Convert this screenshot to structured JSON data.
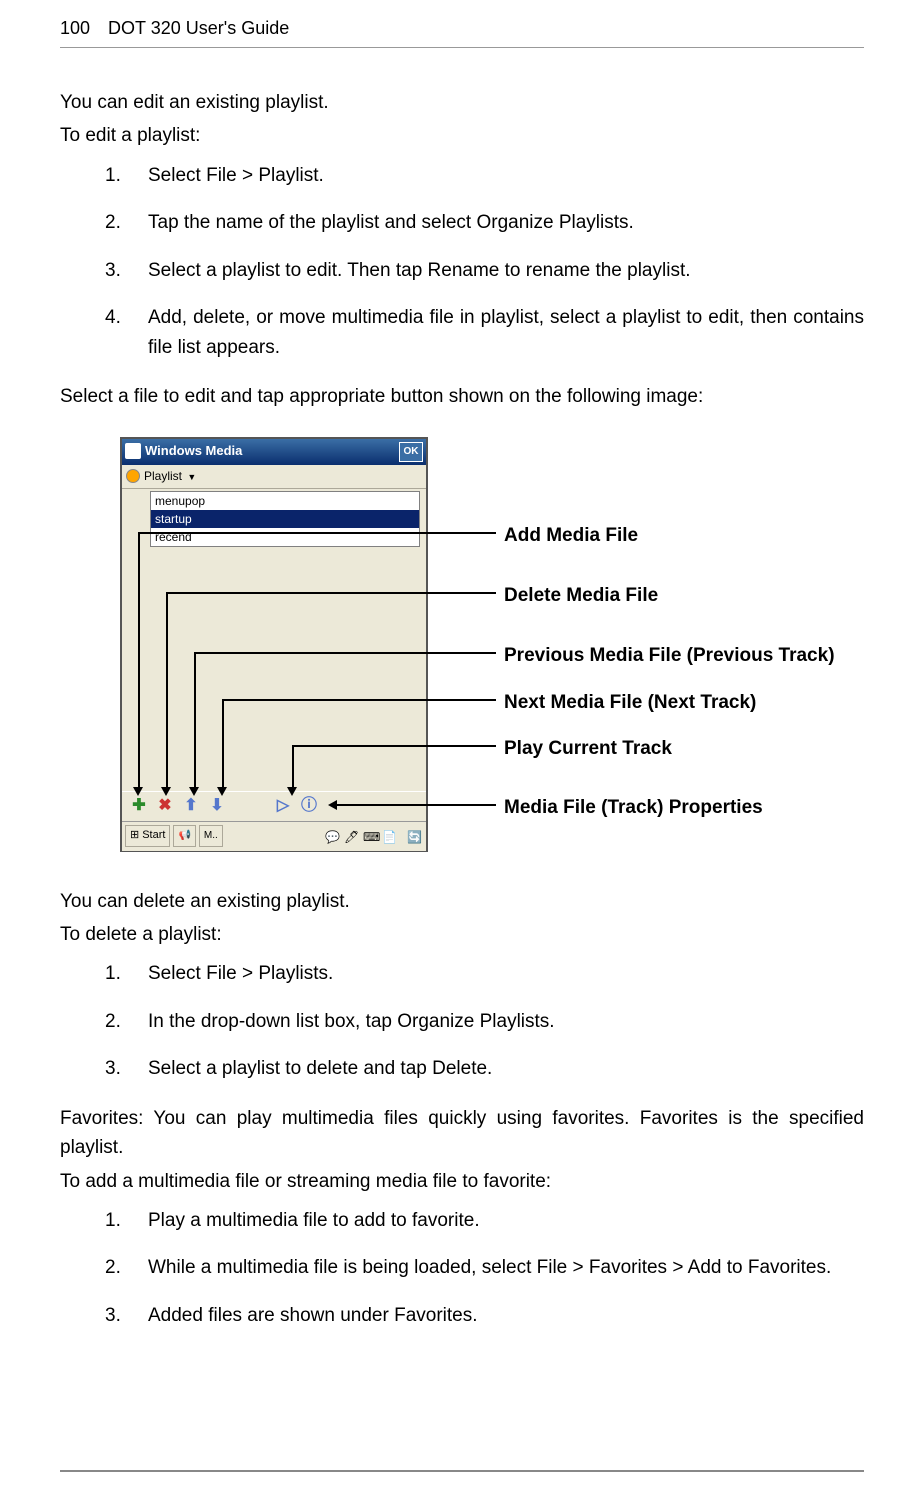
{
  "header": {
    "page_number": "100",
    "title": "DOT 320 User's Guide"
  },
  "section1": {
    "intro": "You can edit an existing playlist.",
    "lead": "To edit a playlist:",
    "steps": [
      "Select File > Playlist.",
      "Tap the name of the playlist and select Organize Playlists.",
      "Select a playlist to edit. Then tap Rename to rename the playlist.",
      "Add, delete, or move multimedia file in playlist, select a playlist to edit, then contains file list appears."
    ],
    "post": "Select a file to edit and tap appropriate button shown on the following image:"
  },
  "screenshot": {
    "titlebar_text": "Windows Media",
    "ok_button": "OK",
    "playlist_label": "Playlist",
    "list_items": [
      "menupop",
      "startup",
      "recend"
    ],
    "selected_index": 1,
    "start_label": "Start",
    "m_label": "M.."
  },
  "annotations": {
    "add": "Add Media File",
    "delete": "Delete Media File",
    "previous": "Previous Media File (Previous Track)",
    "next": "Next Media File (Next Track)",
    "play": "Play Current Track",
    "properties": "Media File (Track) Properties"
  },
  "section2": {
    "intro": "You can delete an existing playlist.",
    "lead": "To delete a playlist:",
    "steps": [
      "Select File > Playlists.",
      "In the drop-down list box, tap Organize Playlists.",
      "Select a playlist to delete and tap Delete."
    ]
  },
  "section3": {
    "intro": "Favorites: You can play multimedia files quickly using favorites. Favorites is the specified playlist.",
    "lead": "To add a multimedia file or streaming media file to favorite:",
    "steps": [
      "Play a multimedia file to add to favorite.",
      "While a multimedia file is being loaded, select File > Favorites > Add to Favorites.",
      "Added files are shown under Favorites."
    ]
  }
}
